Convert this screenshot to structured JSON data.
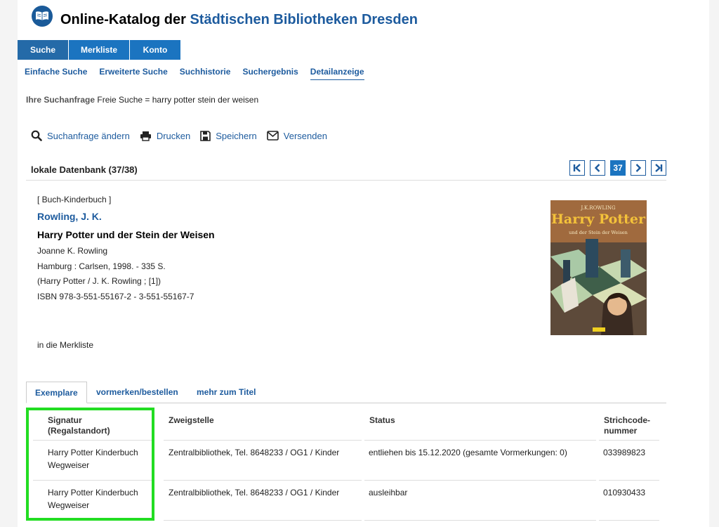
{
  "header": {
    "title_prefix": "Online-Katalog der ",
    "title_brand": "Städtischen Bibliotheken Dresden",
    "logo_icon": "book-logo-icon"
  },
  "main_tabs": [
    {
      "label": "Suche",
      "active": true
    },
    {
      "label": "Merkliste",
      "active": false
    },
    {
      "label": "Konto",
      "active": false
    }
  ],
  "sub_nav": [
    {
      "label": "Einfache Suche"
    },
    {
      "label": "Erweiterte Suche"
    },
    {
      "label": "Suchhistorie"
    },
    {
      "label": "Suchergebnis"
    },
    {
      "label": "Detailanzeige",
      "active": true
    }
  ],
  "query": {
    "label": "Ihre Suchanfrage",
    "text": "Freie Suche = harry potter stein der weisen"
  },
  "actions": [
    {
      "label": "Suchanfrage ändern",
      "icon": "search-icon"
    },
    {
      "label": "Drucken",
      "icon": "print-icon"
    },
    {
      "label": "Speichern",
      "icon": "save-icon"
    },
    {
      "label": "Versenden",
      "icon": "mail-icon"
    }
  ],
  "result": {
    "db_title": "lokale Datenbank (37/38)",
    "current_page": "37"
  },
  "record": {
    "media_type": "[ Buch-Kinderbuch ]",
    "author": "Rowling, J. K.",
    "title": "Harry Potter und der Stein der Weisen",
    "statement": "Joanne K. Rowling",
    "publication": "Hamburg : Carlsen, 1998. - 335 S.",
    "series": "(Harry Potter / J. K. Rowling ; [1])",
    "isbn": "ISBN 978-3-551-55167-2 - 3-551-55167-7",
    "merkliste_link": "in die Merkliste",
    "cover": {
      "author_text": "J.K.ROWLING",
      "title_text": "Harry Potter",
      "subtitle_text": "und der Stein der Weisen"
    }
  },
  "detail_tabs": [
    {
      "label": "Exemplare",
      "active": true
    },
    {
      "label": "vormerken/bestellen"
    },
    {
      "label": "mehr zum Titel"
    }
  ],
  "holdings": {
    "headers": {
      "signatur_line1": "Signatur",
      "signatur_line2": "(Regalstandort)",
      "zweigstelle": "Zweigstelle",
      "status": "Status",
      "barcode_line1": "Strichcode-",
      "barcode_line2": "nummer"
    },
    "rows": [
      {
        "signatur": "Harry Potter Kinderbuch",
        "wegweiser": "Wegweiser",
        "zweigstelle": "Zentralbibliothek, Tel. 8648233 / OG1 / Kinder",
        "status": "entliehen bis 15.12.2020 (gesamte Vormerkungen: 0)",
        "barcode": "033989823"
      },
      {
        "signatur": "Harry Potter Kinderbuch",
        "wegweiser": "Wegweiser",
        "zweigstelle": "Zentralbibliothek, Tel. 8648233 / OG1 / Kinder",
        "status": "ausleihbar",
        "barcode": "010930433"
      }
    ]
  },
  "colors": {
    "link": "#1d5b9e",
    "tab_bg": "#1b74c0",
    "highlight": "#22dd22"
  }
}
